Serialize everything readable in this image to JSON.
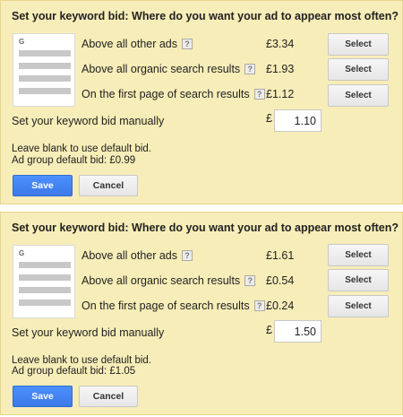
{
  "panels": [
    {
      "title": "Set your keyword bid: Where do you want your ad to appear most often?",
      "thumbnail_letter": "G",
      "options": [
        {
          "label": "Above all other ads",
          "help": "?",
          "price": "£3.34",
          "button": "Select"
        },
        {
          "label": "Above all organic search results",
          "help": "?",
          "price": "£1.93",
          "button": "Select"
        },
        {
          "label": "On the first page of search results",
          "help": "?",
          "price": "£1.12",
          "button": "Select"
        }
      ],
      "manual_label": "Set your keyword bid manually",
      "currency": "£",
      "bid_value": "1.10",
      "hint_line1": "Leave blank to use default bid.",
      "hint_line2": "Ad group default bid: £0.99",
      "save_label": "Save",
      "cancel_label": "Cancel"
    },
    {
      "title": "Set your keyword bid: Where do you want your ad to appear most often?",
      "thumbnail_letter": "G",
      "options": [
        {
          "label": "Above all other ads",
          "help": "?",
          "price": "£1.61",
          "button": "Select"
        },
        {
          "label": "Above all organic search results",
          "help": "?",
          "price": "£0.54",
          "button": "Select"
        },
        {
          "label": "On the first page of search results",
          "help": "?",
          "price": "£0.24",
          "button": "Select"
        }
      ],
      "manual_label": "Set your keyword bid manually",
      "currency": "£",
      "bid_value": "1.50",
      "hint_line1": "Leave blank to use default bid.",
      "hint_line2": "Ad group default bid: £1.05",
      "save_label": "Save",
      "cancel_label": "Cancel"
    }
  ]
}
